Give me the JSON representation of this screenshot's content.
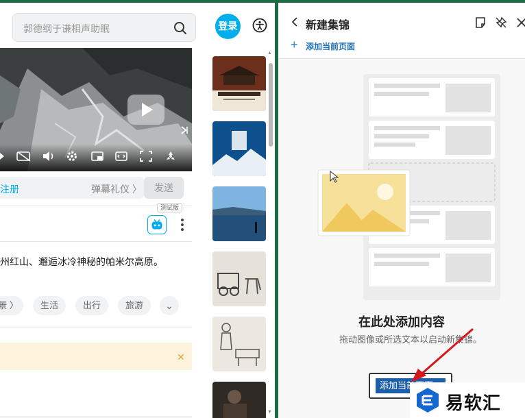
{
  "browser": {
    "search": {
      "placeholder": "郭德纲于谦相声助眠"
    },
    "login_label": "登录"
  },
  "danmu": {
    "login_label": "注册",
    "etiquette_label": "弹幕礼仪 〉",
    "send_label": "发送"
  },
  "video_info": {
    "ai_badge": "测试版",
    "description": "州红山、邂逅冰冷神秘的帕米尔高原。",
    "tags": [
      "景 〉",
      "生活",
      "出行",
      "旅游",
      "⌄"
    ]
  },
  "collections_panel": {
    "title": "新建集锦",
    "add_current_page_label": "添加当前页面",
    "empty_title": "在此处添加内容",
    "empty_subtitle": "拖动图像或所选文本以启动新集锦。",
    "add_button_label": "添加当前页面"
  },
  "watermark": {
    "text": "易软汇"
  },
  "colors": {
    "frame_green": "#1d6b43",
    "accent_blue": "#00aeec",
    "panel_link_blue": "#1f6fb8",
    "notice_bg": "#fdf2dc"
  }
}
